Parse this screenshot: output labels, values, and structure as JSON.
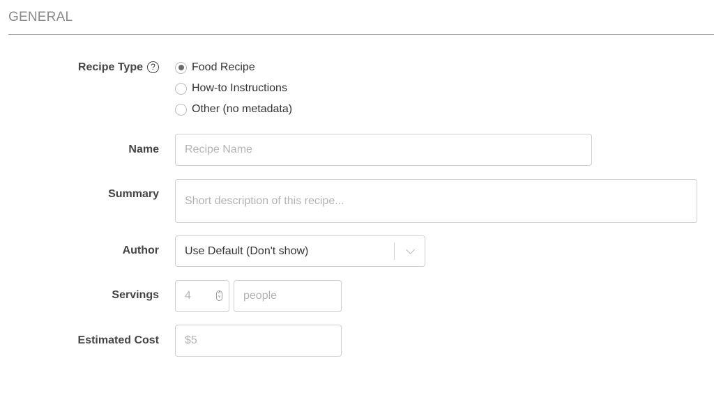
{
  "section": {
    "title": "GENERAL"
  },
  "recipe_type": {
    "label": "Recipe Type",
    "help_glyph": "?",
    "options": [
      {
        "label": "Food Recipe",
        "checked": true
      },
      {
        "label": "How-to Instructions",
        "checked": false
      },
      {
        "label": "Other (no metadata)",
        "checked": false
      }
    ]
  },
  "name": {
    "label": "Name",
    "placeholder": "Recipe Name",
    "value": ""
  },
  "summary": {
    "label": "Summary",
    "placeholder": "Short description of this recipe...",
    "value": ""
  },
  "author": {
    "label": "Author",
    "selected": "Use Default (Don't show)"
  },
  "servings": {
    "label": "Servings",
    "amount_placeholder": "4",
    "unit_placeholder": "people"
  },
  "estimated_cost": {
    "label": "Estimated Cost",
    "placeholder": "$5"
  }
}
